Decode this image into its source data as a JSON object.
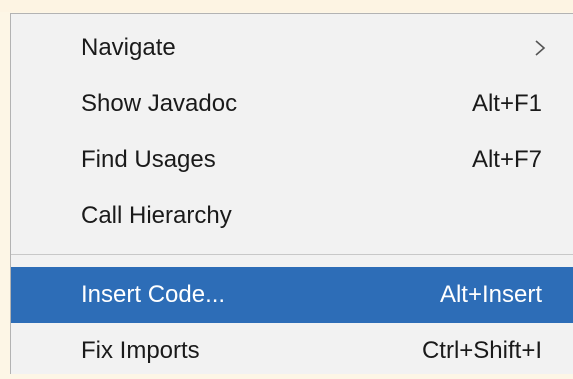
{
  "colors": {
    "selection": "#2d6db7",
    "menu_background": "#f2f2f2",
    "text": "#1a1a1a",
    "selected_text": "#ffffff"
  },
  "menu": {
    "items": [
      {
        "label": "Navigate",
        "shortcut": "",
        "submenu_icon": "chevron-right-icon"
      },
      {
        "label": "Show Javadoc",
        "shortcut": "Alt+F1"
      },
      {
        "label": "Find Usages",
        "shortcut": "Alt+F7"
      },
      {
        "label": "Call Hierarchy",
        "shortcut": ""
      },
      {
        "label": "Insert Code...",
        "shortcut": "Alt+Insert",
        "selected": true
      },
      {
        "label": "Fix Imports",
        "shortcut": "Ctrl+Shift+I"
      }
    ]
  }
}
